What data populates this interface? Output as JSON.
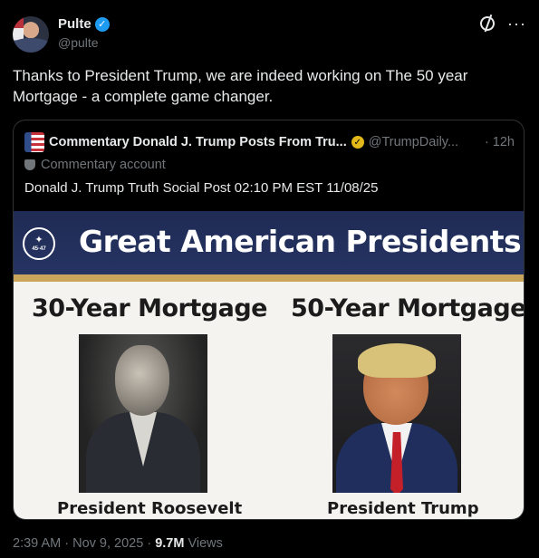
{
  "author": {
    "display_name": "Pulte",
    "handle": "@pulte"
  },
  "icons": {
    "verified": "verified-badge-icon",
    "grok": "grok-icon",
    "more": "more-icon"
  },
  "colors": {
    "verified_blue": "#1d9bf0",
    "affiliate_gold": "#e2b719",
    "background": "#000000"
  },
  "tweet": {
    "text": "Thanks to President Trump, we are indeed working on The 50 year Mortgage  - a complete game changer."
  },
  "quote": {
    "display_name": "Commentary Donald J. Trump Posts From Tru...",
    "handle": "@TrumpDaily...",
    "time": "· 12h",
    "account_label": "Commentary account",
    "text": "Donald J. Trump Truth Social Post 02:10 PM EST 11/08/25",
    "image": {
      "title": "Great American Presidents",
      "seal_text": "45·47",
      "left_heading": "30-Year Mortgage",
      "right_heading": "50-Year Mortgage",
      "left_caption": "President Roosevelt",
      "right_caption": "President Trump"
    }
  },
  "footer": {
    "time": "2:39 AM",
    "sep1": " · ",
    "date": "Nov 9, 2025",
    "sep2": " · ",
    "views_count": "9.7M",
    "views_label": " Views"
  }
}
